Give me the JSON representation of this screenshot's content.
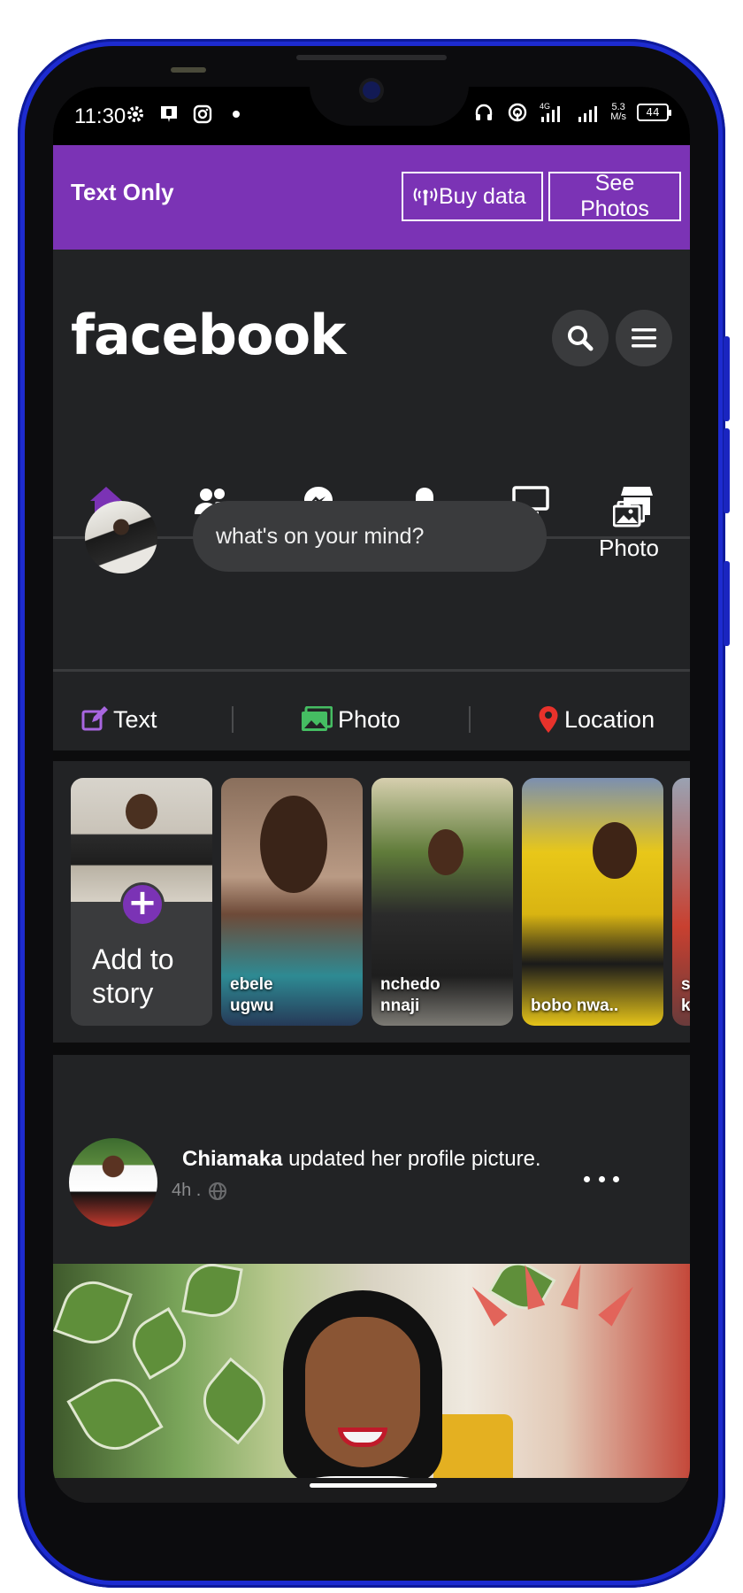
{
  "status_bar": {
    "time": "11:30",
    "network_label": "4G",
    "speed_value": "5.3",
    "speed_unit": "M/s",
    "battery": "44"
  },
  "banner": {
    "title": "Text Only",
    "buy_data_label": "Buy data",
    "see_photos_label": "See Photos",
    "background_color": "#7b33b5"
  },
  "header": {
    "logo": "facebook"
  },
  "nav": {
    "active": "home",
    "items": [
      "home",
      "friends",
      "messenger",
      "notifications",
      "watch",
      "marketplace"
    ]
  },
  "composer": {
    "placeholder": "what's on your mind?",
    "photo_label": "Photo"
  },
  "actions": {
    "text_label": "Text",
    "photo_label": "Photo",
    "location_label": "Location"
  },
  "stories": {
    "add_label_line1": "Add to",
    "add_label_line2": "story",
    "items": [
      {
        "name_line1": "ebele",
        "name_line2": "ugwu"
      },
      {
        "name_line1": "nchedo",
        "name_line2": "nnaji"
      },
      {
        "name_line1": "bobo nwa..",
        "name_line2": ""
      },
      {
        "name_line1": "s",
        "name_line2": "k"
      }
    ]
  },
  "post": {
    "author": "Chiamaka",
    "action": "updated her profile picture.",
    "time": "4h .",
    "privacy_icon": "globe-icon"
  }
}
